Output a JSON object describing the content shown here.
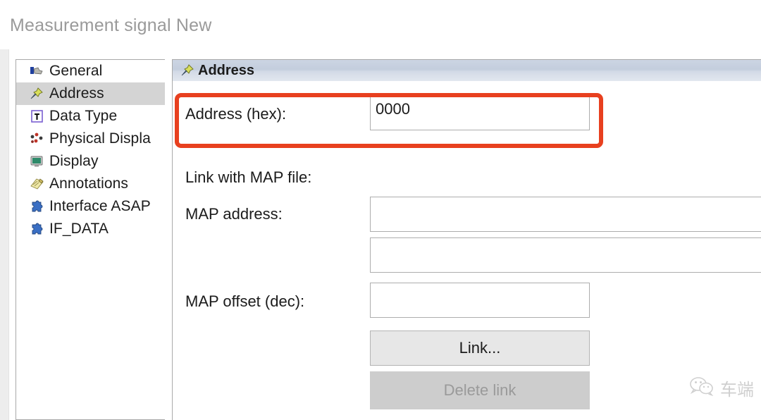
{
  "window": {
    "title": "Measurement signal New"
  },
  "sidebar": {
    "items": [
      {
        "label": "General",
        "icon": "pointer-flag-icon",
        "selected": false
      },
      {
        "label": "Address",
        "icon": "pushpin-icon",
        "selected": true
      },
      {
        "label": "Data Type",
        "icon": "datatype-t-icon",
        "selected": false
      },
      {
        "label": "Physical Displa",
        "icon": "physical-dots-icon",
        "selected": false
      },
      {
        "label": "Display",
        "icon": "monitor-icon",
        "selected": false
      },
      {
        "label": "Annotations",
        "icon": "notepad-icon",
        "selected": false
      },
      {
        "label": "Interface ASAP",
        "icon": "puzzle-icon",
        "selected": false
      },
      {
        "label": "IF_DATA",
        "icon": "puzzle-icon",
        "selected": false
      }
    ]
  },
  "panel": {
    "header": {
      "title": "Address",
      "icon": "pushpin-icon"
    },
    "address_row": {
      "label": "Address (hex):",
      "value": "0000",
      "placeholder": ""
    },
    "map_section": {
      "title": "Link with MAP file:",
      "map_address_label": "MAP address:",
      "map_address_value": "",
      "map_address_placeholder": "",
      "map_address_second_value": "",
      "map_offset_label": "MAP offset (dec):",
      "map_offset_value": "",
      "map_offset_placeholder": "",
      "link_button": "Link...",
      "delete_link_button": "Delete link"
    }
  },
  "watermark": {
    "text": "车端",
    "icon": "wechat-icon"
  },
  "colors": {
    "annotation": "#e8401f",
    "selection": "#d4d4d4",
    "header_gradient_top": "#ccd5e3",
    "title_text": "#9a9a9a",
    "disabled_button": "#cdcdcd"
  }
}
